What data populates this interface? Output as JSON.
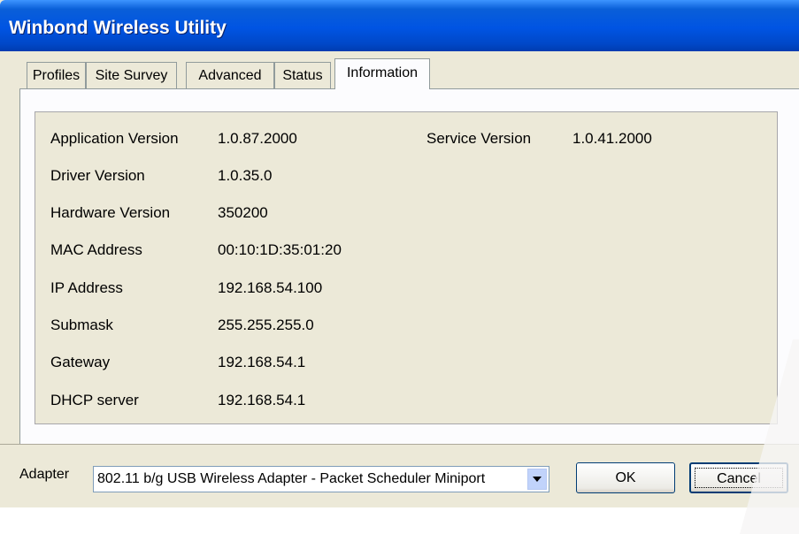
{
  "window": {
    "title": "Winbond Wireless Utility"
  },
  "tabs": [
    {
      "label": "Profiles"
    },
    {
      "label": "Site Survey"
    },
    {
      "label": "Advanced"
    },
    {
      "label": "Status"
    },
    {
      "label": "Information"
    }
  ],
  "active_tab": "Information",
  "info": {
    "app_version": {
      "label": "Application Version",
      "value": "1.0.87.2000"
    },
    "service_version": {
      "label": "Service Version",
      "value": "1.0.41.2000"
    },
    "driver_version": {
      "label": "Driver Version",
      "value": "1.0.35.0"
    },
    "hardware_version": {
      "label": "Hardware Version",
      "value": "350200"
    },
    "mac_address": {
      "label": "MAC Address",
      "value": "00:10:1D:35:01:20"
    },
    "ip_address": {
      "label": "IP Address",
      "value": "192.168.54.100"
    },
    "submask": {
      "label": "Submask",
      "value": "255.255.255.0"
    },
    "gateway": {
      "label": "Gateway",
      "value": "192.168.54.1"
    },
    "dhcp_server": {
      "label": "DHCP server",
      "value": "192.168.54.1"
    }
  },
  "footer": {
    "adapter_label": "Adapter",
    "adapter_value": "802.11 b/g USB Wireless Adapter - Packet Scheduler Miniport",
    "ok_label": "OK",
    "cancel_label": "Cancel"
  }
}
